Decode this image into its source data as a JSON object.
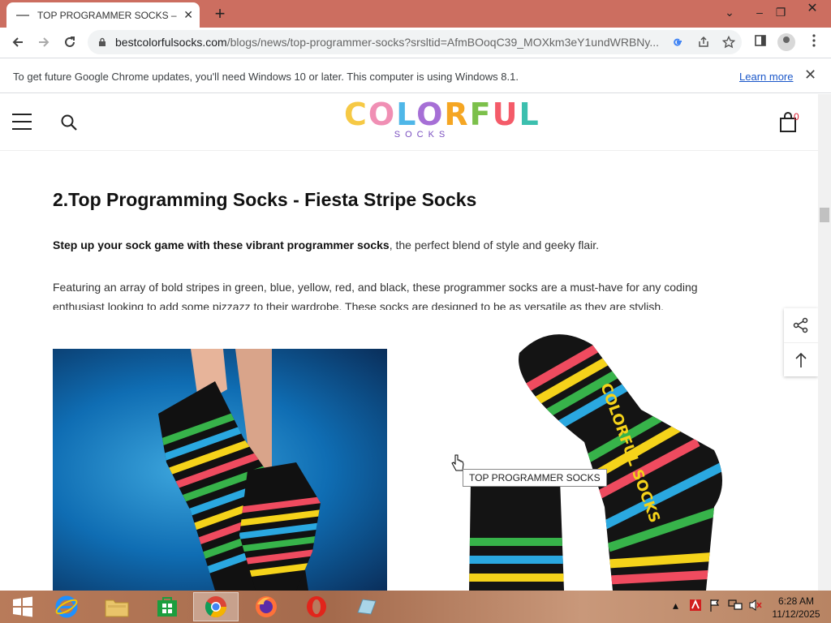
{
  "tab": {
    "title": "TOP PROGRAMMER SOCKS – be",
    "close": "✕"
  },
  "toolbar": {
    "new_tab": "+",
    "url_host": "bestcolorfulsocks.com",
    "url_path": "/blogs/news/top-programmer-socks?srsltid=AfmBOoqC39_MOXkm3eY1undWRBNy..."
  },
  "window_controls": {
    "minimize": "–",
    "restore": "❐",
    "close": "✕",
    "menu": "⌄"
  },
  "infobar": {
    "text": "To get future Google Chrome updates, you'll need Windows 10 or later. This computer is using Windows 8.1.",
    "link": "Learn more",
    "close": "✕"
  },
  "site": {
    "logo_letters": [
      {
        "ch": "C",
        "color": "#f6c945"
      },
      {
        "ch": "O",
        "color": "#f08fb4"
      },
      {
        "ch": "L",
        "color": "#4fb7e8"
      },
      {
        "ch": "O",
        "color": "#a66fd6"
      },
      {
        "ch": "R",
        "color": "#f5a623"
      },
      {
        "ch": "F",
        "color": "#7cc04b"
      },
      {
        "ch": "U",
        "color": "#f45b69"
      },
      {
        "ch": "L",
        "color": "#3cbfae"
      }
    ],
    "logo_sub": "SOCKS",
    "cart_count": "0"
  },
  "article": {
    "heading": "2.Top Programming Socks - Fiesta Stripe Socks",
    "p1_bold": "Step up your sock game with these vibrant programmer socks",
    "p1_rest": ", the perfect blend of style and geeky flair.",
    "p2": "Featuring an array of bold stripes in green, blue, yellow, red, and black, these programmer socks are a must-have for any coding enthusiast looking to add some pizzazz to their wardrobe. These socks are designed to be as versatile as they are stylish.",
    "tooltip": "TOP PROGRAMMER SOCKS",
    "sock_text": "COLORFUL SOCKS"
  },
  "taskbar": {
    "clock_time": "6:28 AM",
    "clock_date": "11/12/2025"
  },
  "colors": {
    "titlebar": "#cc6e60",
    "link": "#1a57c9"
  }
}
